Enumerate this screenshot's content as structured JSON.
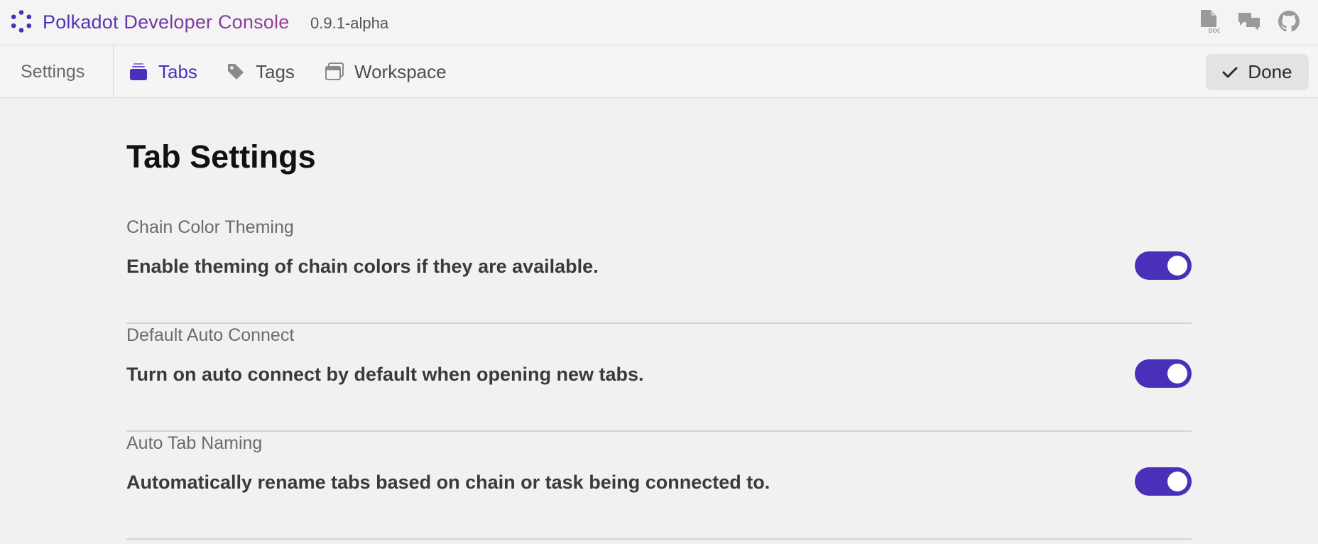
{
  "header": {
    "app_title": "Polkadot Developer Console",
    "version": "0.9.1-alpha",
    "icons": [
      "doc-icon",
      "chat-icon",
      "github-icon"
    ]
  },
  "tabbar": {
    "settings_label": "Settings",
    "tabs": [
      {
        "label": "Tabs",
        "icon": "tabs-stack-icon",
        "active": true
      },
      {
        "label": "Tags",
        "icon": "tag-icon",
        "active": false
      },
      {
        "label": "Workspace",
        "icon": "workspace-icon",
        "active": false
      }
    ],
    "done_label": "Done"
  },
  "page": {
    "title": "Tab Settings",
    "settings": [
      {
        "label": "Chain Color Theming",
        "description": "Enable theming of chain colors if they are available.",
        "enabled": true
      },
      {
        "label": "Default Auto Connect",
        "description": "Turn on auto connect by default when opening new tabs.",
        "enabled": true
      },
      {
        "label": "Auto Tab Naming",
        "description": "Automatically rename tabs based on chain or task being connected to.",
        "enabled": true
      }
    ]
  },
  "colors": {
    "accent": "#4a2fb8",
    "background": "#f1f1f1",
    "toggle_knob": "#ffffff"
  }
}
